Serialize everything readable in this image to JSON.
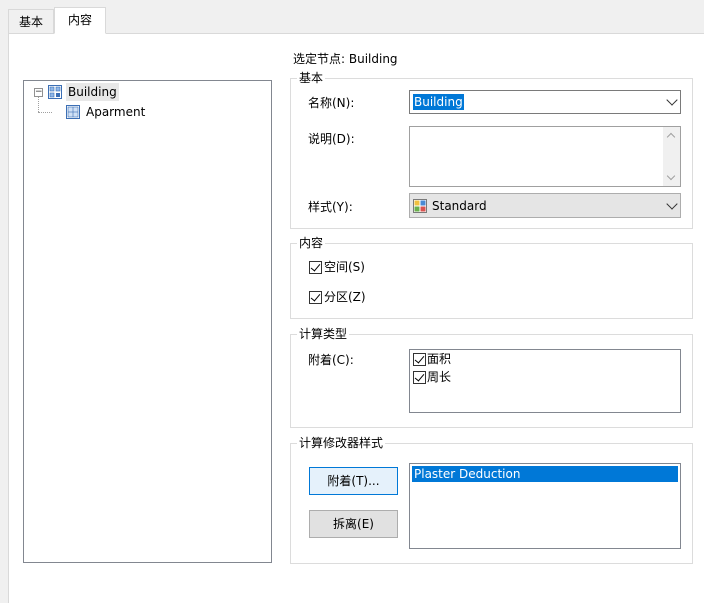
{
  "tabs": [
    {
      "label": "基本",
      "active": false
    },
    {
      "label": "内容",
      "active": true
    }
  ],
  "tree": {
    "root": {
      "label": "Building",
      "icon": "building-icon",
      "expander": "−"
    },
    "children": [
      {
        "label": "Aparment",
        "icon": "apartment-icon"
      }
    ]
  },
  "selected_node": "选定节点: Building",
  "group_basic": {
    "title": "基本",
    "name_label": "名称(N):",
    "name_value": "Building",
    "desc_label": "说明(D):",
    "desc_value": "",
    "style_label": "样式(Y):",
    "style_value": "Standard"
  },
  "group_content": {
    "title": "内容",
    "items": [
      {
        "label": "空间(S)",
        "checked": true
      },
      {
        "label": "分区(Z)",
        "checked": true
      }
    ]
  },
  "group_calc_type": {
    "title": "计算类型",
    "attach_label": "附着(C):",
    "items": [
      {
        "label": "面积",
        "checked": true
      },
      {
        "label": "周长",
        "checked": true
      }
    ]
  },
  "group_modifier": {
    "title": "计算修改器样式",
    "attach_button": "附着(T)...",
    "detach_button": "拆离(E)",
    "list": [
      {
        "label": "Plaster Deduction",
        "selected": true
      }
    ]
  },
  "colors": {
    "selection": "#0078d7",
    "border": "#828790"
  }
}
